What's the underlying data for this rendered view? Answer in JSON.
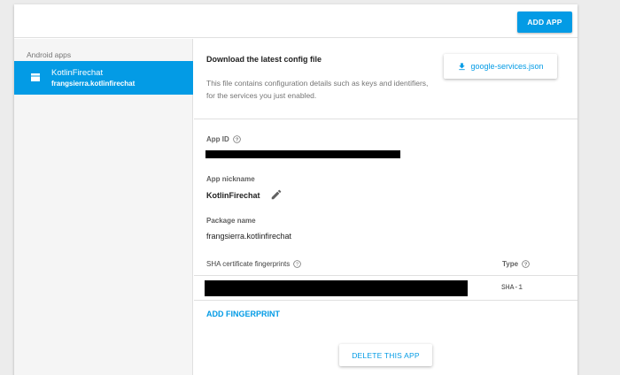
{
  "header": {
    "add_app_label": "ADD APP"
  },
  "sidebar": {
    "heading": "Android apps",
    "items": [
      {
        "name": "KotlinFirechat",
        "package": "frangsierra.kotlinfirechat",
        "selected": true,
        "icon": "android-app-icon"
      }
    ]
  },
  "config": {
    "title": "Download the latest config file",
    "description": "This file contains configuration details such as keys and identifiers, for the services you just enabled.",
    "download_label": "google-services.json",
    "download_icon": "download-icon"
  },
  "fields": {
    "app_id_label": "App ID",
    "app_nickname_label": "App nickname",
    "app_nickname_value": "KotlinFirechat",
    "package_name_label": "Package name",
    "package_name_value": "frangsierra.kotlinfirechat"
  },
  "fingerprints": {
    "column_label": "SHA certificate fingerprints",
    "type_label": "Type",
    "rows": [
      {
        "type": "SHA-1"
      }
    ],
    "add_label": "ADD FINGERPRINT"
  },
  "actions": {
    "delete_label": "DELETE THIS APP"
  },
  "colors": {
    "accent": "#039be5",
    "background": "#ececec",
    "sidebar": "#f5f5f5"
  }
}
